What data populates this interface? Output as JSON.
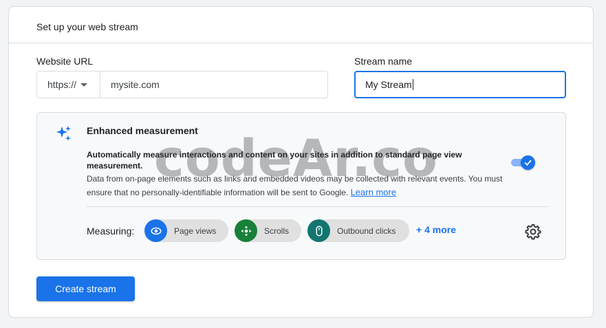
{
  "card": {
    "title": "Set up your web stream"
  },
  "form": {
    "website_url_label": "Website URL",
    "protocol_value": "https://",
    "url_value": "mysite.com",
    "stream_name_label": "Stream name",
    "stream_name_value": "My Stream"
  },
  "enhanced": {
    "title": "Enhanced measurement",
    "desc_bold": "Automatically measure interactions and content on your sites in addition to standard page view measurement.",
    "desc": "Data from on-page elements such as links and embedded videos may be collected with relevant events. You must ensure that no personally-identifiable information will be sent to Google.",
    "learn_more": "Learn more",
    "toggle_on": true,
    "measuring_label": "Measuring:",
    "chips": [
      {
        "label": "Page views",
        "icon": "eye-icon",
        "color": "#1a73e8"
      },
      {
        "label": "Scrolls",
        "icon": "scroll-target-icon",
        "color": "#188038"
      },
      {
        "label": "Outbound clicks",
        "icon": "mouse-icon",
        "color": "#137570"
      }
    ],
    "more_label": "+ 4 more"
  },
  "actions": {
    "create_label": "Create stream"
  },
  "watermark": "codeAr.co",
  "colors": {
    "accent": "#1a73e8"
  }
}
